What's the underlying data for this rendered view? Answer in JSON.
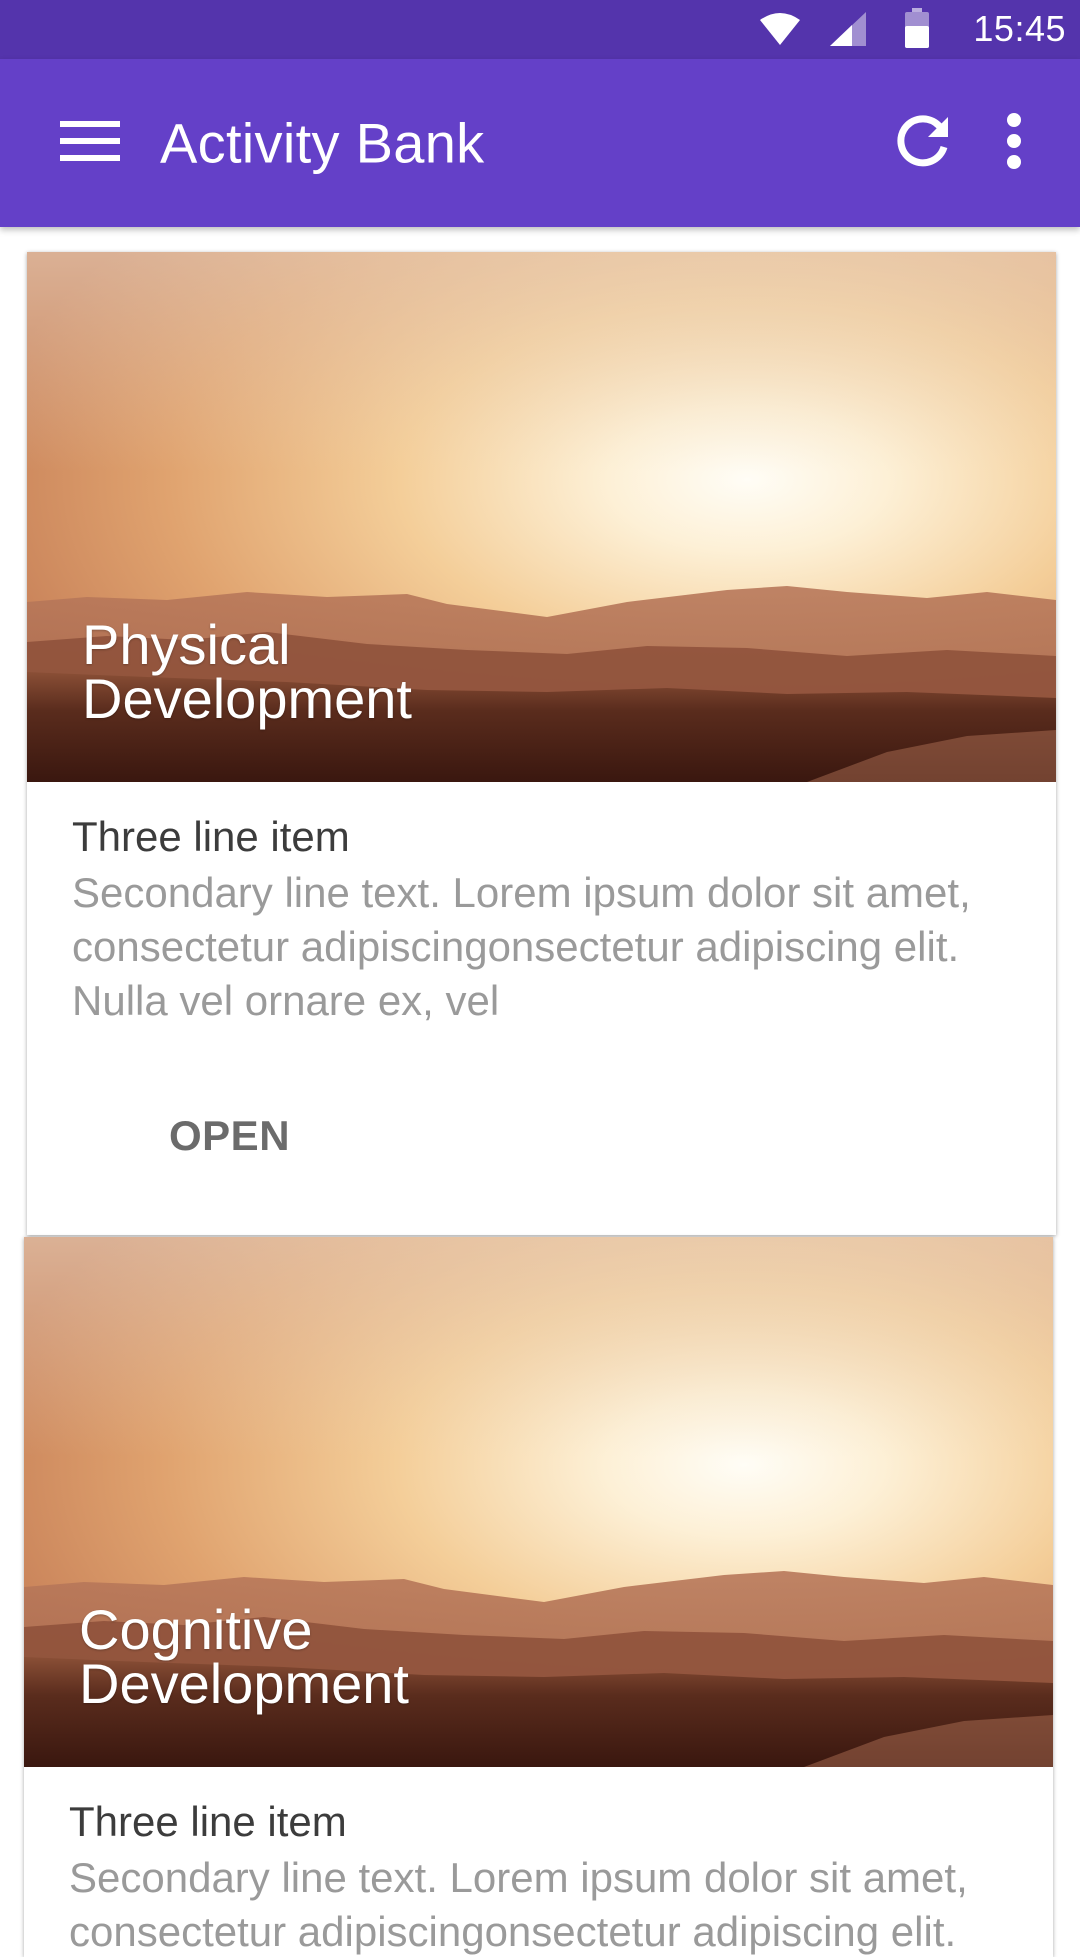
{
  "status_bar": {
    "time": "15:45",
    "icons": [
      "wifi-icon",
      "signal-icon",
      "battery-icon"
    ],
    "background": "#5434ac"
  },
  "app_bar": {
    "title": "Activity Bank",
    "background": "#6440c8",
    "icons": [
      "menu-icon",
      "refresh-icon",
      "more-vert-icon"
    ]
  },
  "cards": [
    {
      "title_line1": "Physical",
      "title_line2": "Development",
      "heading": "Three line item",
      "secondary": "Secondary line text. Lorem ipsum dolor sit amet, consectetur adipiscingonsectetur adipiscing  elit. Nulla vel ornare ex, vel",
      "action": "OPEN"
    },
    {
      "title_line1": "Cognitive",
      "title_line2": "Development",
      "heading": "Three line item",
      "secondary": "Secondary line text. Lorem ipsum dolor sit amet, consectetur adipiscingonsectetur adipiscing  elit. Nulla vel ornare ex, vel"
    }
  ]
}
